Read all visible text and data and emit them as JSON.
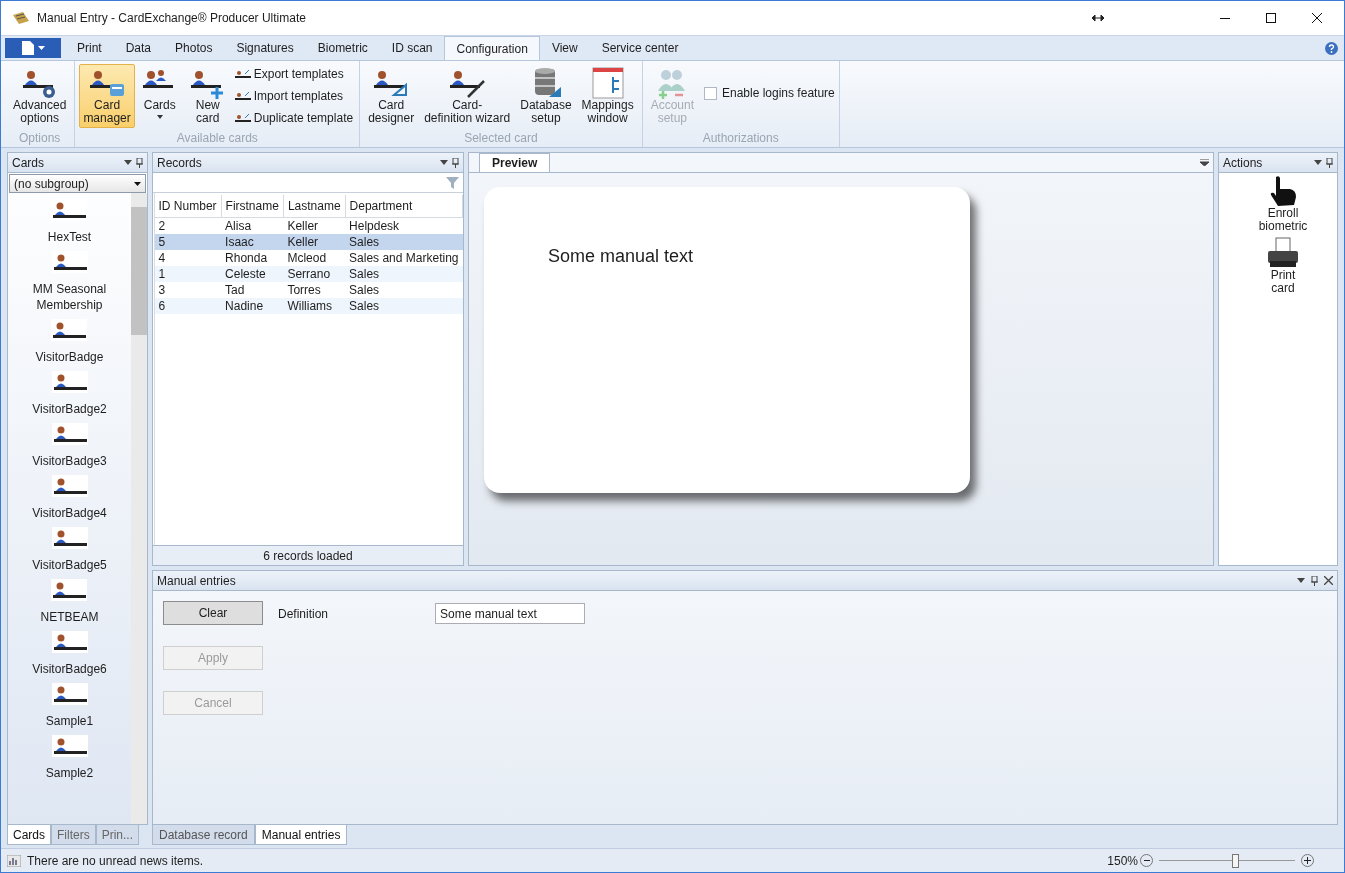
{
  "window": {
    "title": "Manual Entry - CardExchange® Producer Ultimate"
  },
  "ribbon": {
    "tabs": [
      {
        "label": "Print",
        "selected": false
      },
      {
        "label": "Data",
        "selected": false
      },
      {
        "label": "Photos",
        "selected": false
      },
      {
        "label": "Signatures",
        "selected": false
      },
      {
        "label": "Biometric",
        "selected": false
      },
      {
        "label": "ID scan",
        "selected": false
      },
      {
        "label": "Configuration",
        "selected": true
      },
      {
        "label": "View",
        "selected": false
      },
      {
        "label": "Service center",
        "selected": false
      }
    ],
    "groups": [
      {
        "label": "Options",
        "items": [
          {
            "kind": "large",
            "lines": [
              "Advanced",
              "options"
            ],
            "selected": false,
            "disabled": false
          }
        ]
      },
      {
        "label": "Available cards",
        "items": [
          {
            "kind": "large",
            "lines": [
              "Card",
              "manager"
            ],
            "selected": true,
            "disabled": false
          },
          {
            "kind": "dropdown",
            "lines": [
              "Cards"
            ],
            "selected": false,
            "disabled": false
          },
          {
            "kind": "large",
            "lines": [
              "New",
              "card"
            ],
            "selected": false,
            "disabled": false
          },
          {
            "kind": "small",
            "label": "Export templates"
          },
          {
            "kind": "small",
            "label": "Import templates"
          },
          {
            "kind": "small",
            "label": "Duplicate template"
          }
        ]
      },
      {
        "label": "Selected card",
        "items": [
          {
            "kind": "large",
            "lines": [
              "Card",
              "designer"
            ],
            "selected": false,
            "disabled": false
          },
          {
            "kind": "large",
            "lines": [
              "Card-",
              "definition wizard"
            ],
            "selected": false,
            "disabled": false
          },
          {
            "kind": "large",
            "lines": [
              "Database",
              "setup"
            ],
            "selected": false,
            "disabled": false
          },
          {
            "kind": "large",
            "lines": [
              "Mappings",
              "window"
            ],
            "selected": false,
            "disabled": false
          }
        ]
      },
      {
        "label": "Authorizations",
        "items": [
          {
            "kind": "large",
            "lines": [
              "Account",
              "setup"
            ],
            "selected": false,
            "disabled": true
          },
          {
            "kind": "checkbox",
            "label": "Enable logins feature",
            "checked": false
          }
        ]
      }
    ]
  },
  "cards_panel": {
    "title": "Cards",
    "subgroup": "(no subgroup)",
    "items": [
      "HexTest",
      "MM Seasonal Membership",
      "VisitorBadge",
      "VisitorBadge2",
      "VisitorBadge3",
      "VisitorBadge4",
      "VisitorBadge5",
      "NETBEAM",
      "VisitorBadge6",
      "Sample1",
      "Sample2"
    ],
    "tabs": [
      {
        "label": "Cards",
        "selected": true
      },
      {
        "label": "Filters",
        "selected": false
      },
      {
        "label": "Prin...",
        "selected": false
      }
    ]
  },
  "records": {
    "title": "Records",
    "columns": [
      "ID Number",
      "Firstname",
      "Lastname",
      "Department"
    ],
    "rows": [
      {
        "cells": [
          "2",
          "Alisa",
          "Keller",
          "Helpdesk"
        ],
        "selected": false
      },
      {
        "cells": [
          "5",
          "Isaac",
          "Keller",
          "Sales"
        ],
        "selected": true
      },
      {
        "cells": [
          "4",
          "Rhonda",
          "Mcleod",
          "Sales and Marketing"
        ],
        "selected": false
      },
      {
        "cells": [
          "1",
          "Celeste",
          "Serrano",
          "Sales"
        ],
        "selected": false
      },
      {
        "cells": [
          "3",
          "Tad",
          "Torres",
          "Sales"
        ],
        "selected": false
      },
      {
        "cells": [
          "6",
          "Nadine",
          "Williams",
          "Sales"
        ],
        "selected": false
      }
    ],
    "footer": "6 records loaded"
  },
  "preview": {
    "tab": "Preview",
    "card_text": "Some manual text"
  },
  "actions": {
    "title": "Actions",
    "items": [
      {
        "lines": [
          "Enroll",
          "biometric"
        ]
      },
      {
        "lines": [
          "Print",
          "card"
        ]
      }
    ]
  },
  "manual_entries": {
    "title": "Manual entries",
    "buttons": [
      {
        "label": "Clear",
        "disabled": false
      },
      {
        "label": "Apply",
        "disabled": true
      },
      {
        "label": "Cancel",
        "disabled": true
      }
    ],
    "fields": [
      {
        "label": "Definition",
        "value": "Some manual text"
      }
    ]
  },
  "bottom_tabs": [
    {
      "label": "Database record",
      "selected": false
    },
    {
      "label": "Manual entries",
      "selected": true
    }
  ],
  "status_bar": {
    "message": "There are no unread news items.",
    "zoom": "150%",
    "level": 0.56
  }
}
